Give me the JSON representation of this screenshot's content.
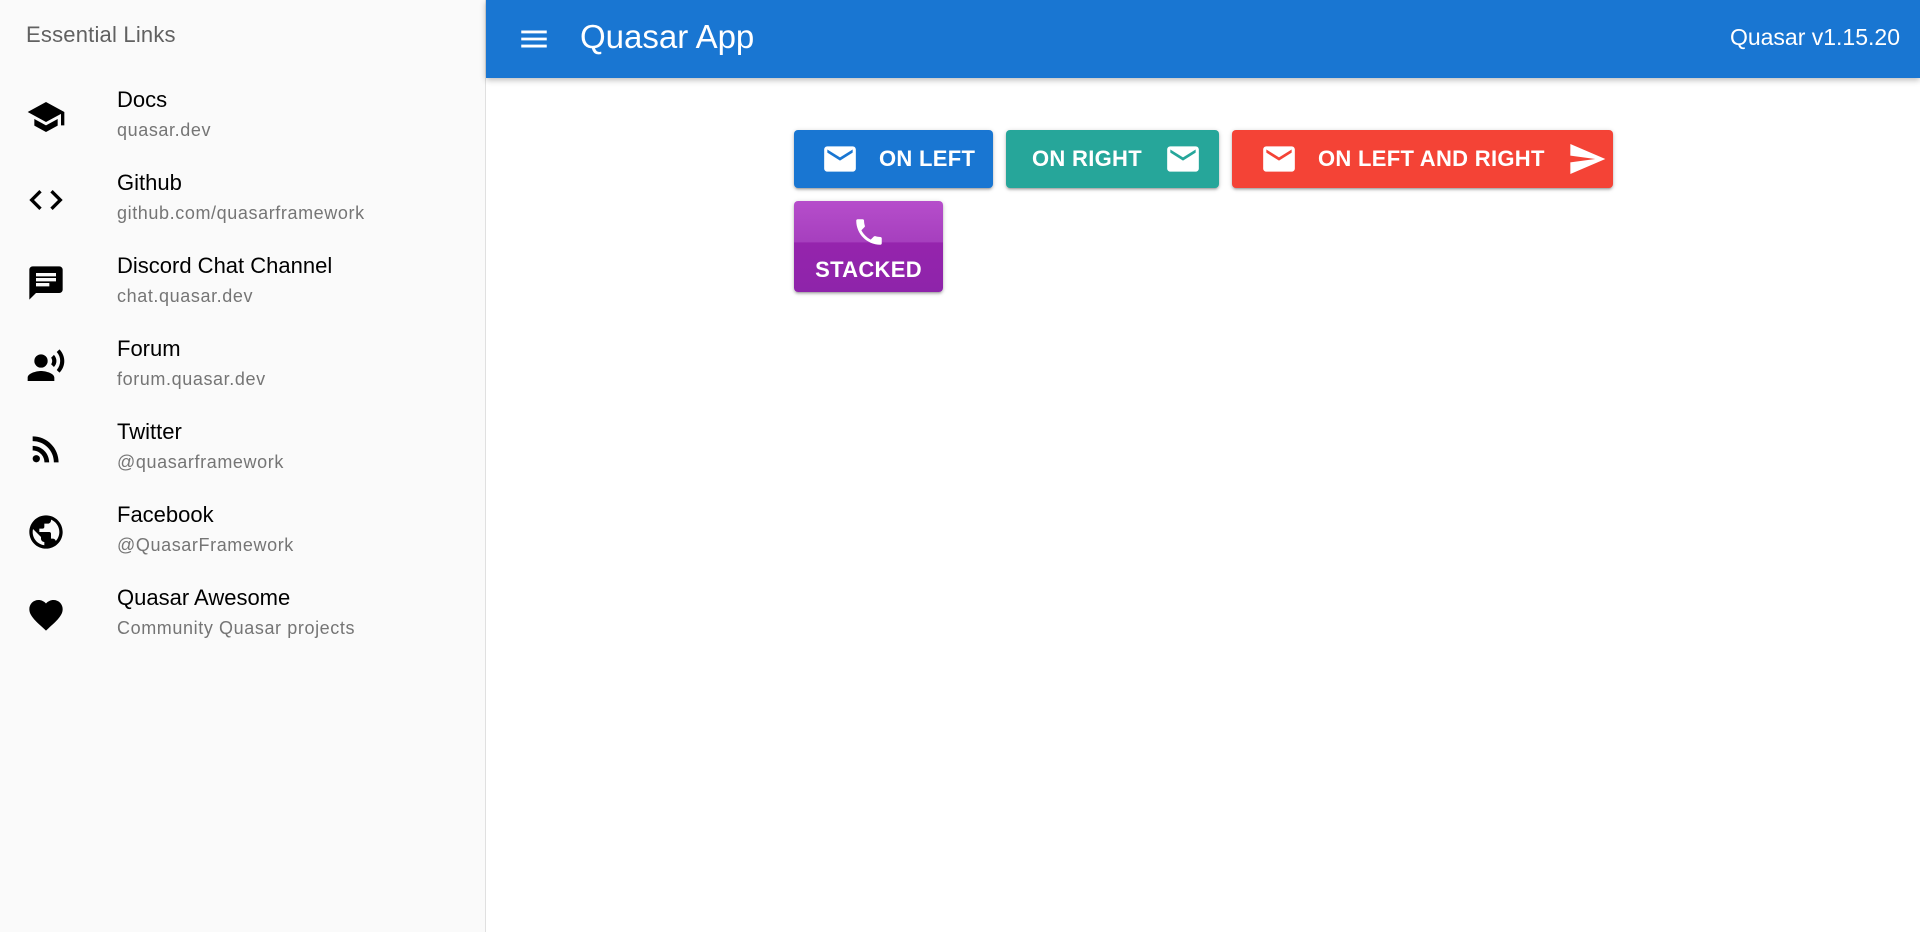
{
  "drawer": {
    "header": "Essential Links",
    "links": [
      {
        "title": "Docs",
        "caption": "quasar.dev",
        "icon": "school-icon"
      },
      {
        "title": "Github",
        "caption": "github.com/quasarframework",
        "icon": "code-icon"
      },
      {
        "title": "Discord Chat Channel",
        "caption": "chat.quasar.dev",
        "icon": "chat-icon"
      },
      {
        "title": "Forum",
        "caption": "forum.quasar.dev",
        "icon": "record-voice-icon"
      },
      {
        "title": "Twitter",
        "caption": "@quasarframework",
        "icon": "rss-feed-icon"
      },
      {
        "title": "Facebook",
        "caption": "@QuasarFramework",
        "icon": "public-icon"
      },
      {
        "title": "Quasar Awesome",
        "caption": "Community Quasar projects",
        "icon": "favorite-icon"
      }
    ]
  },
  "header": {
    "title": "Quasar App",
    "version": "Quasar v1.15.20",
    "color": "#1976d2"
  },
  "buttons": {
    "on_left": {
      "label": "ON LEFT",
      "color": "#1976d2"
    },
    "on_right": {
      "label": "ON RIGHT",
      "color": "#26a69a"
    },
    "on_left_and_right": {
      "label": "ON LEFT AND RIGHT",
      "color": "#f44336"
    },
    "stacked": {
      "label": "STACKED",
      "color": "#9c27b0"
    }
  }
}
